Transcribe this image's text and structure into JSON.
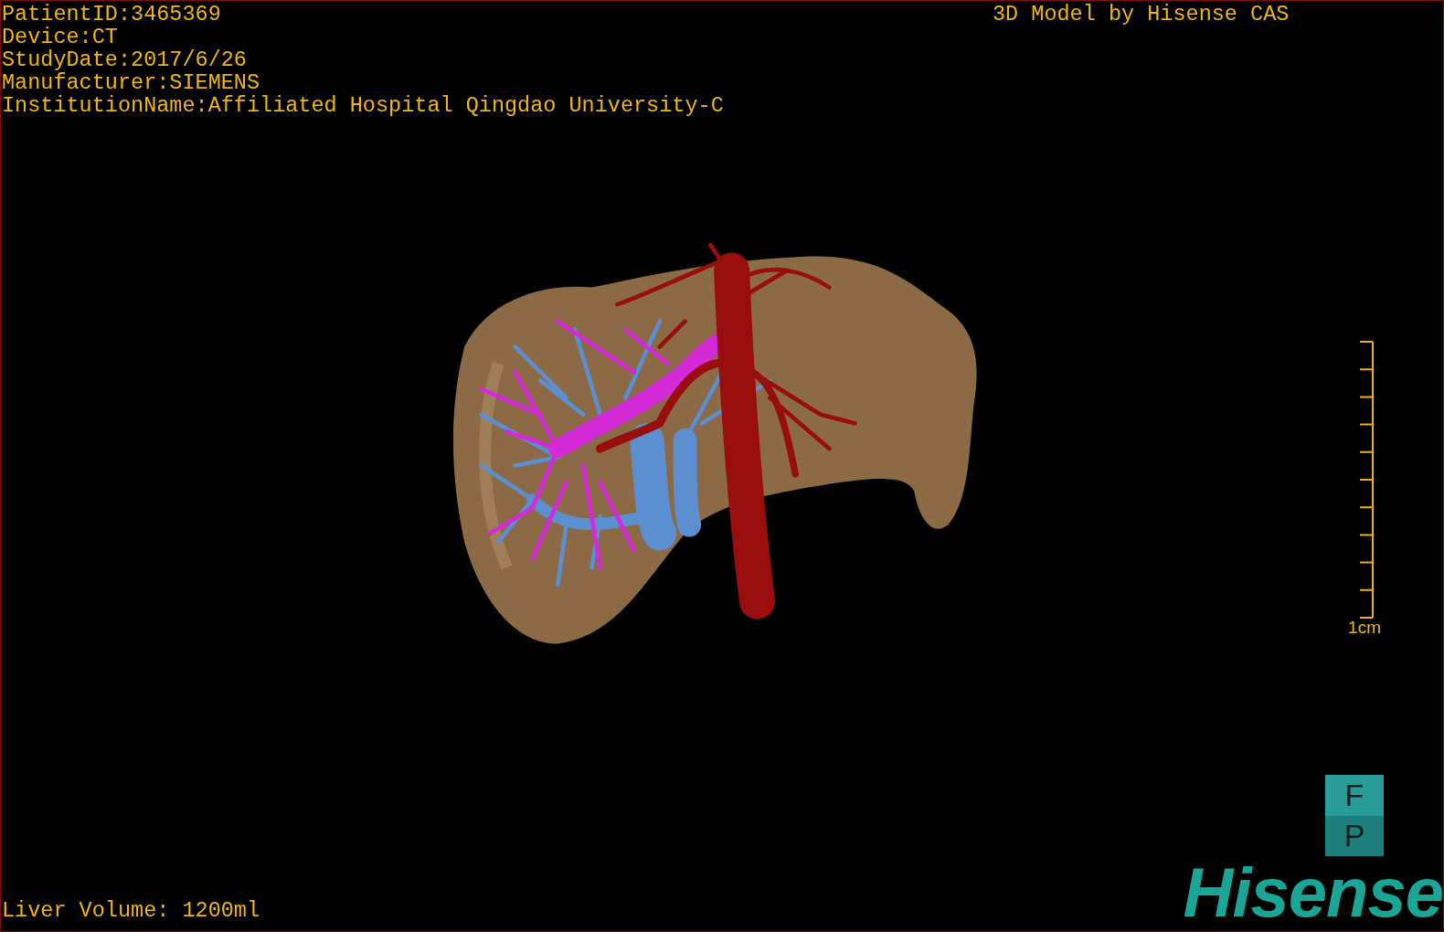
{
  "viewport": {
    "info_lines": [
      "PatientID:3465369",
      "Device:CT",
      "StudyDate:2017/6/26",
      "Manufacturer:SIEMENS",
      "InstitutionName:Affiliated Hospital Qingdao University-C"
    ],
    "title": "3D Model by Hisense CAS",
    "volume": "Liver Volume: 1200ml"
  },
  "scale_bar": {
    "label": "1cm"
  },
  "orientation_cube": {
    "top": "F",
    "bottom": "P"
  },
  "logo": {
    "text": "Hisense"
  }
}
